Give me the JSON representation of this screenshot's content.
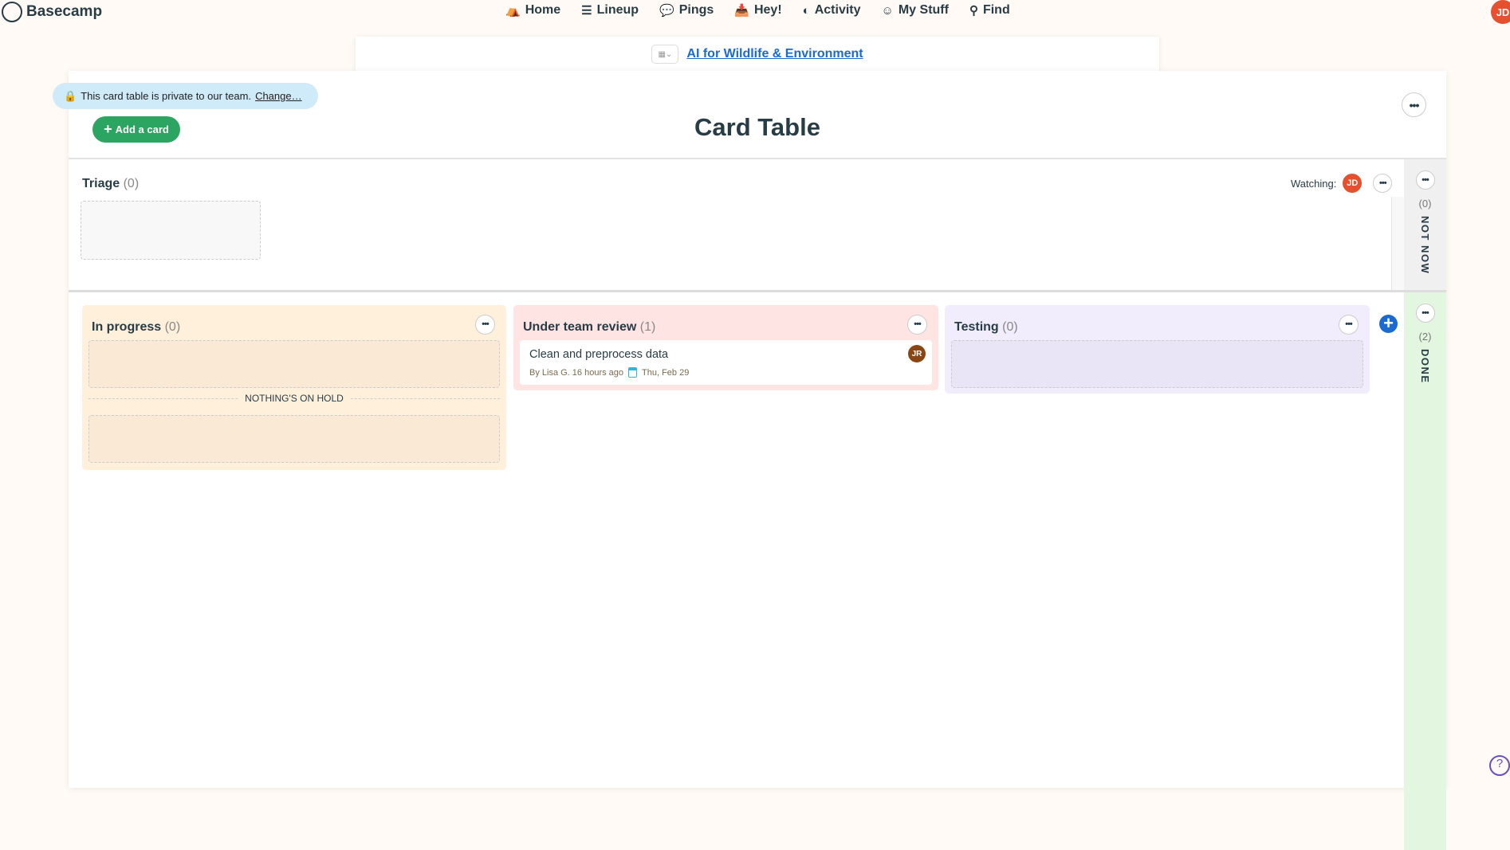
{
  "nav": {
    "brand": "Basecamp",
    "items": [
      {
        "label": "Home",
        "icon": "home-icon"
      },
      {
        "label": "Lineup",
        "icon": "lineup-icon"
      },
      {
        "label": "Pings",
        "icon": "pings-icon"
      },
      {
        "label": "Hey!",
        "icon": "hey-icon"
      },
      {
        "label": "Activity",
        "icon": "activity-icon"
      },
      {
        "label": "My Stuff",
        "icon": "smiley-icon"
      },
      {
        "label": "Find",
        "icon": "search-icon"
      }
    ],
    "avatar": "JD"
  },
  "project": {
    "name": "AI for Wildlife & Environment"
  },
  "privacy": {
    "text": "This card table is private to our team.",
    "link": "Change…"
  },
  "add_card": "Add a card",
  "title": "Card Table",
  "triage": {
    "name": "Triage",
    "count": "(0)",
    "watching": "Watching:",
    "watcher": "JD"
  },
  "not_now": {
    "count": "(0)",
    "label": "NOT NOW"
  },
  "done": {
    "count": "(2)",
    "label": "DONE"
  },
  "columns": [
    {
      "name": "In progress",
      "count": "(0)",
      "on_hold": "NOTHING'S ON HOLD",
      "color": "#fff0dc"
    },
    {
      "name": "Under team review",
      "count": "(1)",
      "color": "#ffe4e4",
      "cards": [
        {
          "title": "Clean and preprocess data",
          "meta": "By Lisa G. 16 hours ago",
          "due": "Thu, Feb 29",
          "assignee": "JR"
        }
      ]
    },
    {
      "name": "Testing",
      "count": "(0)",
      "color": "#f1edfd"
    }
  ],
  "colors": {
    "accent": "#2da562",
    "link": "#1a6ad2",
    "avatar": "#e5502f",
    "assignee": "#8b4513"
  }
}
